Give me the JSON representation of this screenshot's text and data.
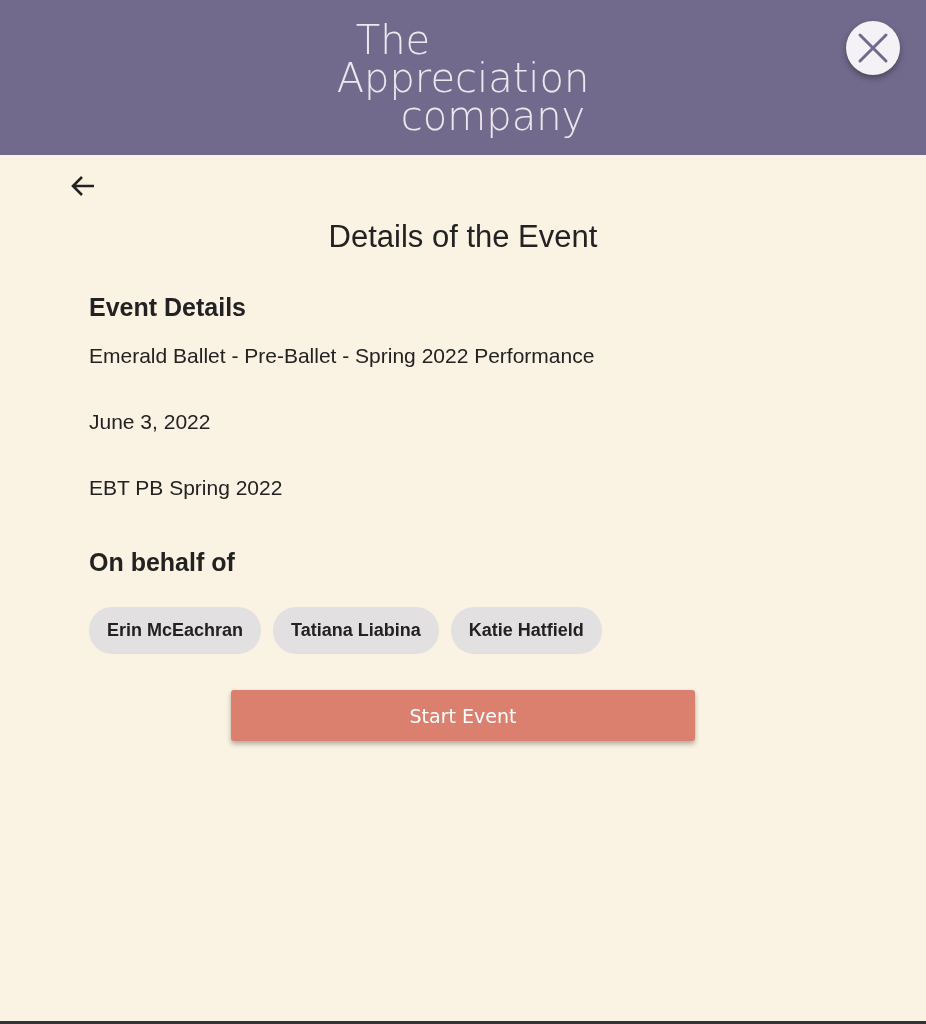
{
  "header": {
    "logo_lines": [
      "The",
      "Appreciation",
      "company"
    ]
  },
  "page_title": "Details of the Event",
  "event_details": {
    "heading": "Event Details",
    "lines": [
      "Emerald Ballet - Pre-Ballet - Spring 2022 Performance",
      "June 3, 2022",
      "EBT PB Spring 2022"
    ]
  },
  "on_behalf_of": {
    "heading": "On behalf of",
    "people": [
      "Erin McEachran",
      "Tatiana Liabina",
      "Katie Hatfield"
    ]
  },
  "primary_button": "Start Event"
}
